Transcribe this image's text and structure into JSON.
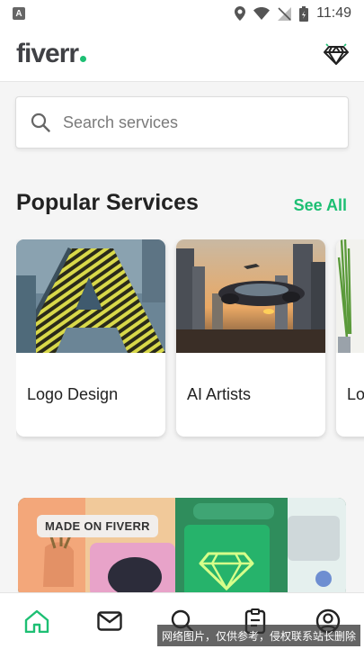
{
  "status_bar": {
    "time": "11:49",
    "app_icon_letter": "A"
  },
  "header": {
    "logo_text": "fiverr",
    "brand_color": "#1dbf73"
  },
  "search": {
    "placeholder": "Search services"
  },
  "popular": {
    "title": "Popular Services",
    "see_all": "See All",
    "cards": [
      {
        "label": "Logo Design"
      },
      {
        "label": "AI Artists"
      },
      {
        "label": "Lo"
      }
    ]
  },
  "banner": {
    "badge": "MADE ON FIVERR"
  },
  "bottom_nav": {
    "items": [
      {
        "icon": "home-icon",
        "active": true
      },
      {
        "icon": "mail-icon"
      },
      {
        "icon": "search-icon"
      },
      {
        "icon": "orders-icon"
      },
      {
        "icon": "profile-icon"
      }
    ]
  },
  "watermark": "网络图片，仅供参考，侵权联系站长删除"
}
